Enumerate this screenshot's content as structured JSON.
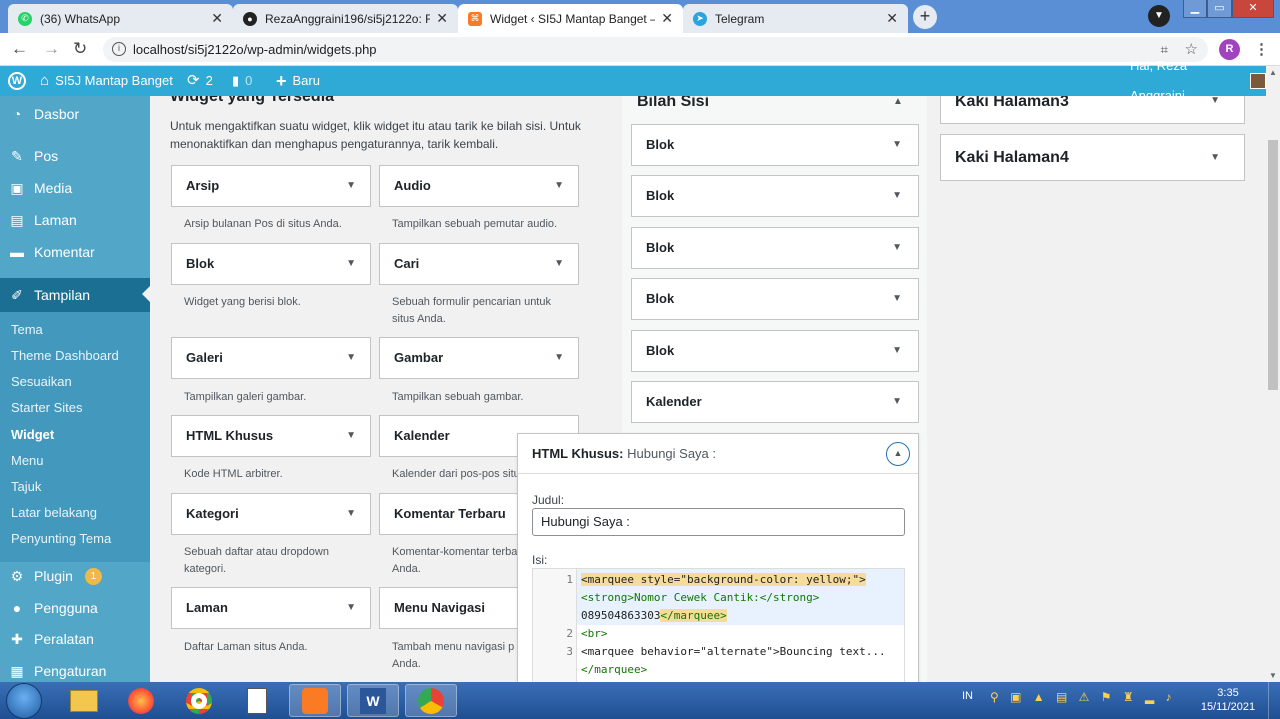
{
  "browser": {
    "tabs": [
      {
        "label": "(36) WhatsApp",
        "icon": "whatsapp-icon",
        "active": false
      },
      {
        "label": "RezaAnggraini196/si5j2122o: Rep",
        "icon": "github-icon",
        "active": false
      },
      {
        "label": "Widget ‹ SI5J Mantap Banget —",
        "icon": "xampp-icon",
        "active": true
      },
      {
        "label": "Telegram",
        "icon": "telegram-icon",
        "active": false
      }
    ],
    "url": "localhost/si5j2122o/wp-admin/widgets.php",
    "profile_initial": "R"
  },
  "adminbar": {
    "site_name": "SI5J Mantap Banget",
    "updates_count": "2",
    "comments_count": "0",
    "new_label": "Baru",
    "greeting": "Hai, Reza Anggraini"
  },
  "sidebar": {
    "items": [
      {
        "label": "Dasbor",
        "icon": "dashboard-icon"
      },
      {
        "label": "Pos",
        "icon": "pin-icon"
      },
      {
        "label": "Media",
        "icon": "media-icon"
      },
      {
        "label": "Laman",
        "icon": "page-icon"
      },
      {
        "label": "Komentar",
        "icon": "comment-icon"
      },
      {
        "label": "Tampilan",
        "icon": "brush-icon"
      },
      {
        "label": "Plugin",
        "icon": "plugin-icon",
        "badge": "1"
      },
      {
        "label": "Pengguna",
        "icon": "user-icon"
      },
      {
        "label": "Peralatan",
        "icon": "wrench-icon"
      },
      {
        "label": "Pengaturan",
        "icon": "settings-icon"
      }
    ],
    "submenu": [
      "Tema",
      "Theme Dashboard",
      "Sesuaikan",
      "Starter Sites",
      "Widget",
      "Menu",
      "Tajuk",
      "Latar belakang",
      "Penyunting Tema"
    ]
  },
  "available": {
    "title": "Widget yang Tersedia",
    "description": "Untuk mengaktifkan suatu widget, klik widget itu atau tarik ke bilah sisi. Untuk menonaktifkan dan menghapus pengaturannya, tarik kembali.",
    "widgets": [
      {
        "name": "Arsip",
        "desc": "Arsip bulanan Pos di situs Anda."
      },
      {
        "name": "Audio",
        "desc": "Tampilkan sebuah pemutar audio."
      },
      {
        "name": "Blok",
        "desc": "Widget yang berisi blok."
      },
      {
        "name": "Cari",
        "desc": "Sebuah formulir pencarian untuk situs Anda."
      },
      {
        "name": "Galeri",
        "desc": "Tampilkan galeri gambar."
      },
      {
        "name": "Gambar",
        "desc": "Tampilkan sebuah gambar."
      },
      {
        "name": "HTML Khusus",
        "desc": "Kode HTML arbitrer."
      },
      {
        "name": "Kalender",
        "desc": "Kalender dari pos-pos situs"
      },
      {
        "name": "Kategori",
        "desc": "Sebuah daftar atau dropdown kategori."
      },
      {
        "name": "Komentar Terbaru",
        "desc": "Komentar-komentar terbaru situs Anda."
      },
      {
        "name": "Laman",
        "desc": "Daftar Laman situs Anda."
      },
      {
        "name": "Menu Navigasi",
        "desc": "Tambah menu navigasi p sidebar Anda."
      }
    ]
  },
  "sidebar_area": {
    "title": "Bilah Sisi",
    "widgets": [
      "Blok",
      "Blok",
      "Blok",
      "Blok",
      "Blok",
      "Kalender"
    ]
  },
  "footer_areas": [
    "Kaki Halaman3",
    "Kaki Halaman4"
  ],
  "open_widget": {
    "type": "HTML Khusus:",
    "title": "Hubungi Saya :",
    "judul_label": "Judul:",
    "judul_value": "Hubungi Saya :",
    "isi_label": "Isi:",
    "line1_a": "<marquee style=\"background-color: yellow;\">",
    "line1_b": "<strong>Nomor Cewek Cantik:</strong>",
    "line1_c": "089504863303",
    "line1_d": "</marquee>",
    "line2": "<br>",
    "line3_a": "<marquee behavior=\"alternate\">Bouncing text...",
    "line3_b": "</marquee>",
    "ln1": "1",
    "ln2": "2",
    "ln3": "3"
  },
  "taskbar": {
    "language": "IN",
    "time": "3:35",
    "date": "15/11/2021"
  },
  "colors": {
    "adminbar": "#2fa9d5",
    "sidebar": "#52a7c8",
    "sidebar_current": "#1a6f93",
    "taskbar": "#1f4f93"
  }
}
